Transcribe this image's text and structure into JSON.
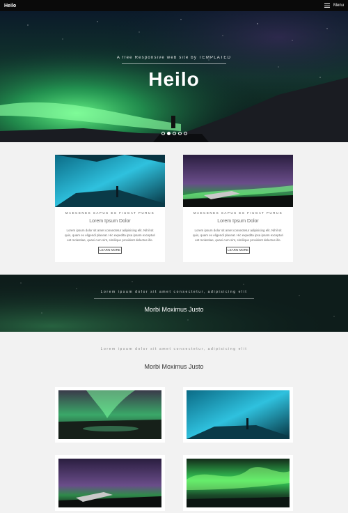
{
  "header": {
    "logo": "Heilo",
    "menu_label": "Menu"
  },
  "hero": {
    "subtitle": "A free Responsive web site by TEMPLATED",
    "title": "Heilo",
    "slides": 5,
    "active_slide": 2
  },
  "cards": [
    {
      "tag": "MAECENES SAPUS ES FIUGAT PURUS",
      "title": "Lorem Ipsum Dolor",
      "body": "Lorem ipsum dolor sit amet consectetur adipisicing elit. Nihil sit quis, quam ex eligendi placeat. Hic expedita ipsa ipsam excepturi est molestiae, quasi cum sint, similique provident delectus illo.",
      "button": "LEARN MORE"
    },
    {
      "tag": "MAECENES SAPUS ES FIUGAT PURUS",
      "title": "Lorem Ipsum Dolor",
      "body": "Lorem ipsum dolor sit amet consectetur adipisicing elit. Nihil sit quis, quam ex eligendi placeat. Hic expedita ipsa ipsam excepturi est molestiae, quasi cum sint, similique provident delectus illo.",
      "button": "LEARN MORE"
    }
  ],
  "banner": {
    "subtitle": "Lorem ipsum dolor sit amet consectetur, adipisicing elit",
    "title": "Morbi Moximus Justo"
  },
  "gallery": {
    "subtitle": "Lorem ipsum dolor sit amet consectetur, adipisicing elit",
    "title": "Morbi Moximus Justo"
  },
  "colors": {
    "header_bg": "#0a0a0a",
    "page_bg": "#f2f2f2",
    "aurora_green": "#4cff7a"
  }
}
